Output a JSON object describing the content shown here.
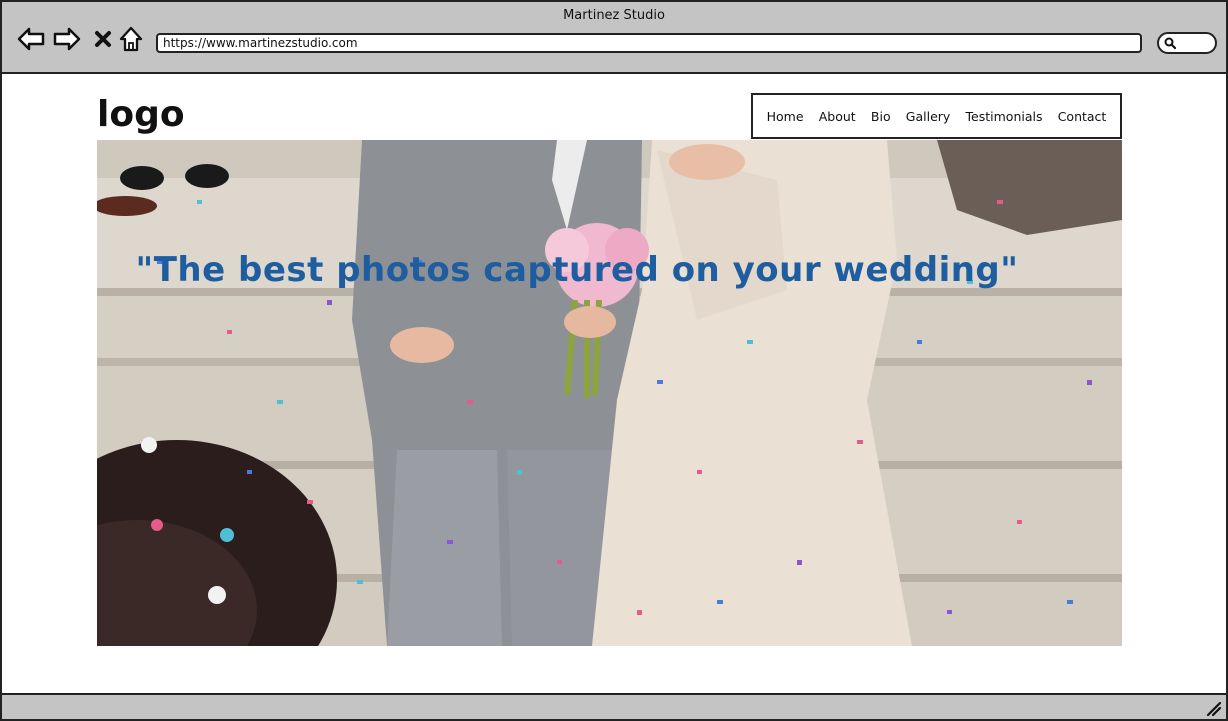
{
  "window": {
    "title": "Martinez Studio"
  },
  "browser": {
    "url": "https://www.martinezstudio.com",
    "buttons": {
      "back": "back-arrow-icon",
      "forward": "forward-arrow-icon",
      "stop": "close-icon",
      "home": "home-icon",
      "search": "search-icon"
    }
  },
  "page": {
    "logo": "logo",
    "nav": [
      {
        "label": "Home"
      },
      {
        "label": "About"
      },
      {
        "label": "Bio"
      },
      {
        "label": "Gallery"
      },
      {
        "label": "Testimonials"
      },
      {
        "label": "Contact"
      }
    ],
    "hero": {
      "tagline": "\"The best photos captured on your wedding\""
    }
  },
  "colors": {
    "chrome": "#c4c4c4",
    "tagline": "#1e5ea0"
  }
}
